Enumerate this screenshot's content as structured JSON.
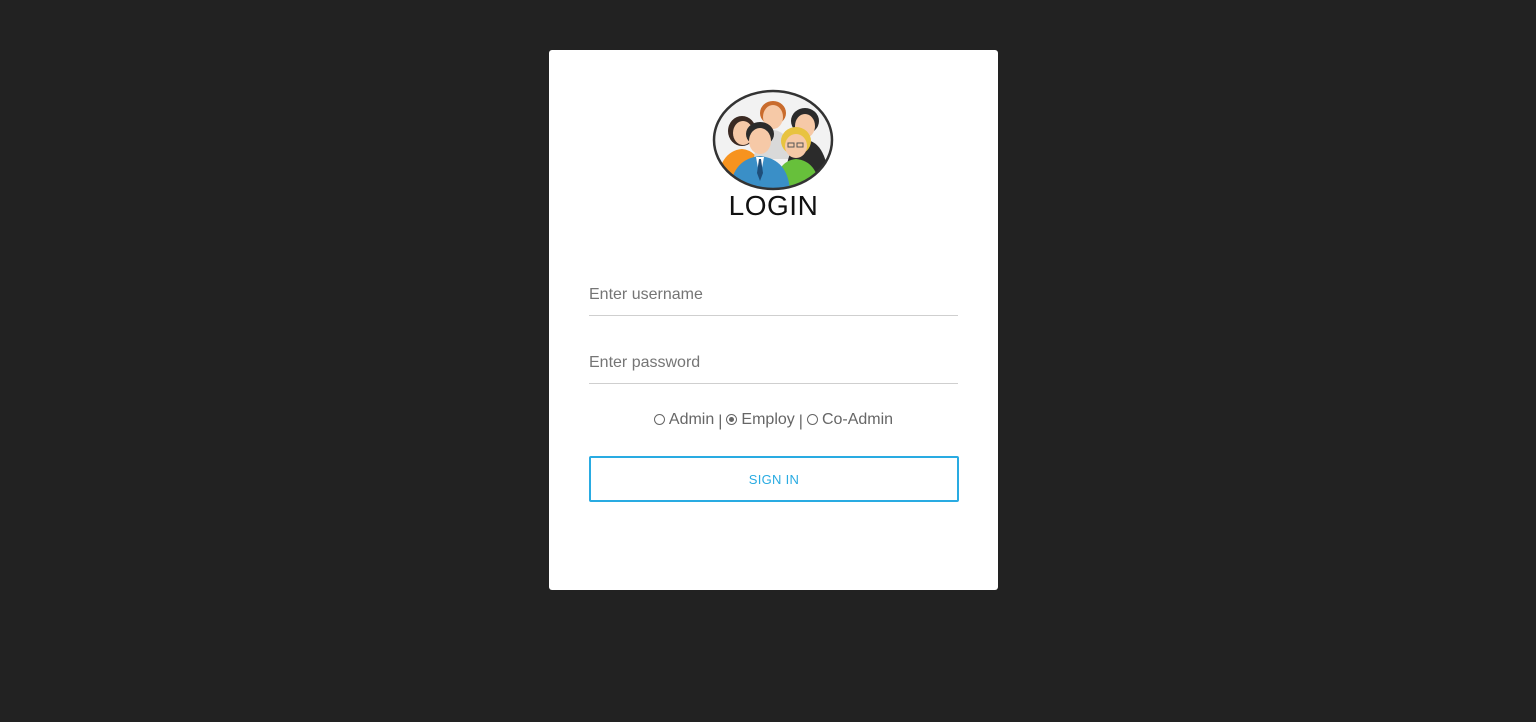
{
  "login": {
    "title": "LOGIN",
    "avatar_icon": "team-people-icon",
    "username": {
      "placeholder": "Enter username",
      "value": ""
    },
    "password": {
      "placeholder": "Enter password",
      "value": ""
    },
    "roles": [
      {
        "label": "Admin",
        "checked": false
      },
      {
        "label": "Employ",
        "checked": true
      },
      {
        "label": "Co-Admin",
        "checked": false
      }
    ],
    "separator": "|",
    "signin_label": "SIGN IN"
  },
  "colors": {
    "background": "#222222",
    "card": "#ffffff",
    "accent": "#29abe2"
  }
}
